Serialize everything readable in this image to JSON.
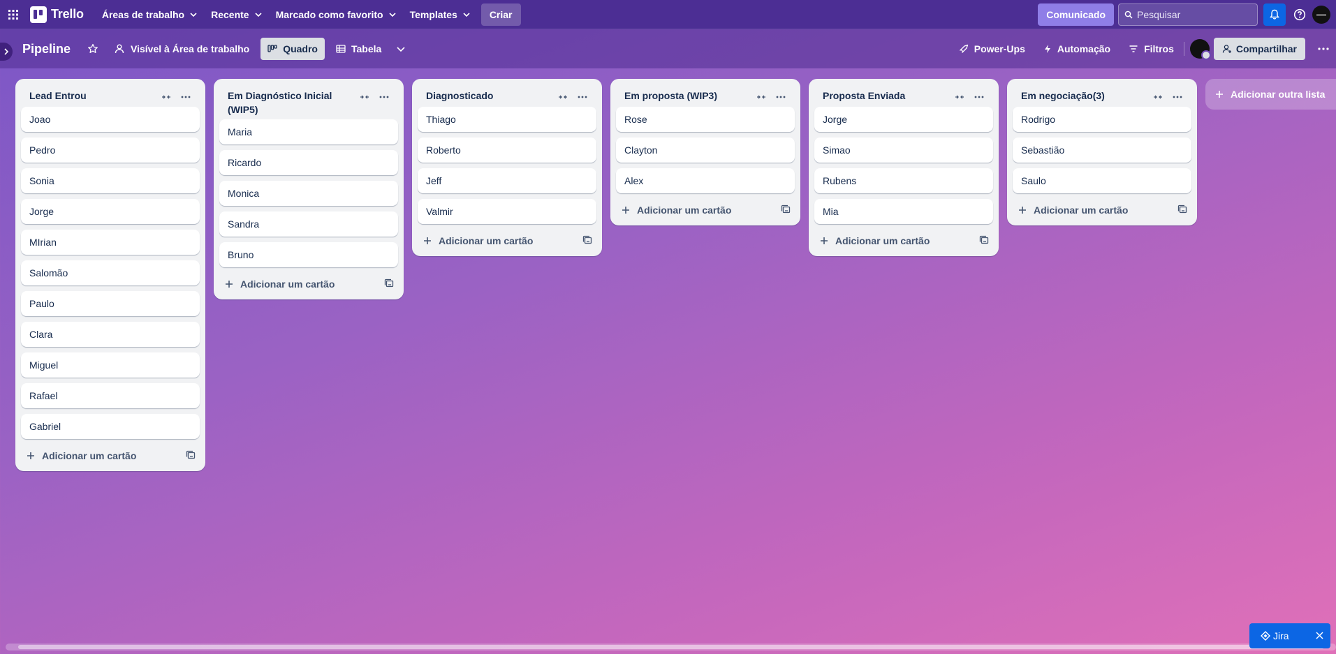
{
  "topnav": {
    "app_name": "Trello",
    "menus": [
      "Áreas de trabalho",
      "Recente",
      "Marcado como favorito",
      "Templates"
    ],
    "create_label": "Criar",
    "announcement_label": "Comunicado",
    "search_placeholder": "Pesquisar"
  },
  "board": {
    "title": "Pipeline",
    "visibility_label": "Visível à Área de trabalho",
    "views": [
      "Quadro",
      "Tabela"
    ],
    "active_view": "Quadro",
    "right_actions": [
      "Power-Ups",
      "Automação",
      "Filtros"
    ],
    "share_label": "Compartilhar"
  },
  "lists": [
    {
      "title": "Lead Entrou",
      "cards": [
        "Joao",
        "Pedro",
        "Sonia",
        "Jorge",
        "MIrian",
        "Salomão",
        "Paulo",
        "Clara",
        "Miguel",
        "Rafael",
        "Gabriel"
      ],
      "add_label": "Adicionar um cartão"
    },
    {
      "title": "Em Diagnóstico Inicial (WIP5)",
      "cards": [
        "Maria",
        "Ricardo",
        "Monica",
        "Sandra",
        "Bruno"
      ],
      "add_label": "Adicionar um cartão"
    },
    {
      "title": "Diagnosticado",
      "cards": [
        "Thiago",
        "Roberto",
        "Jeff",
        "Valmir"
      ],
      "add_label": "Adicionar um cartão"
    },
    {
      "title": "Em proposta (WIP3)",
      "cards": [
        "Rose",
        "Clayton",
        "Alex"
      ],
      "add_label": "Adicionar um cartão"
    },
    {
      "title": "Proposta Enviada",
      "cards": [
        "Jorge",
        "Simao",
        "Rubens",
        "Mia"
      ],
      "add_label": "Adicionar um cartão"
    },
    {
      "title": "Em negociação(3)",
      "cards": [
        "Rodrigo",
        "Sebastião",
        "Saulo"
      ],
      "add_label": "Adicionar um cartão"
    }
  ],
  "add_list_label": "Adicionar outra lista",
  "jira_widget_label": "Jira",
  "colors": {
    "topnav_bg": "#4c2e94",
    "announce_bg": "#8f7ee7",
    "notification_bg": "#0c66e4",
    "list_bg": "#f1f2f4"
  }
}
